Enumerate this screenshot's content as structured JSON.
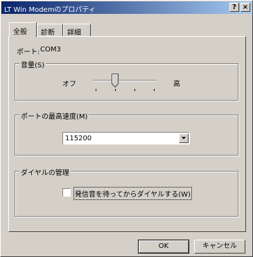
{
  "window": {
    "title": "LT Win Modemのプロパティ",
    "help_label": "?",
    "close_label": "×"
  },
  "tabs": [
    {
      "label": "全般",
      "selected": true
    },
    {
      "label": "診断",
      "selected": false
    },
    {
      "label": "詳細",
      "selected": false
    }
  ],
  "general": {
    "port_label": "ポート:",
    "port_value": "COM3",
    "volume": {
      "group_title": "音量(S)",
      "low_label": "オフ",
      "high_label": "高",
      "level_index": 1,
      "level_count": 4
    },
    "speed": {
      "group_title": "ポートの最高速度(M)",
      "selected_value": "115200"
    },
    "dial": {
      "group_title": "ダイヤルの管理",
      "wait_dialtone_label": "発信音を待ってからダイヤルする(W)",
      "wait_dialtone_checked": false
    }
  },
  "buttons": {
    "ok_label": "OK",
    "cancel_label": "キャンセル"
  }
}
